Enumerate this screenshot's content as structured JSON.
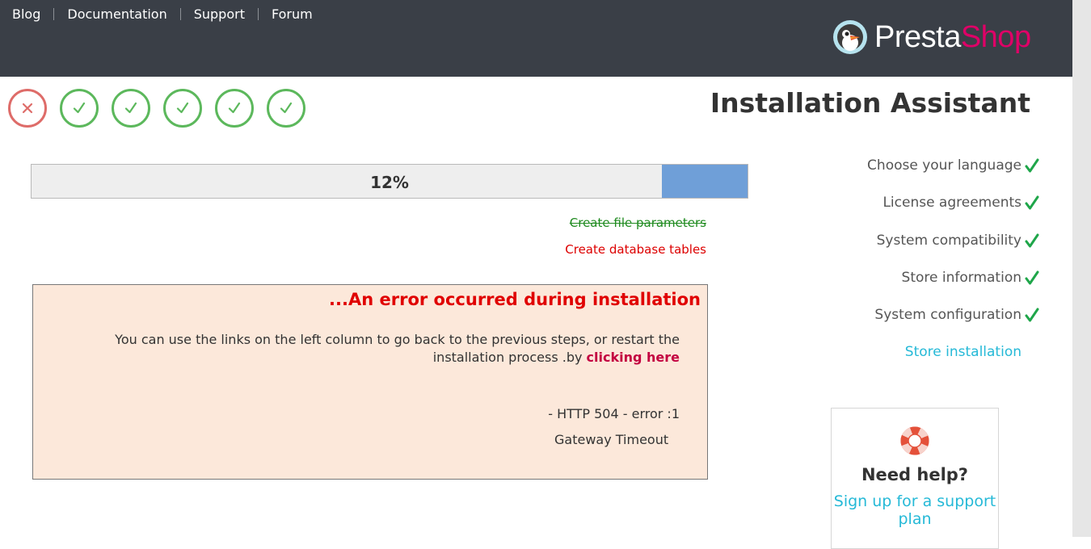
{
  "nav": {
    "items": [
      "Blog",
      "Documentation",
      "Support",
      "Forum"
    ]
  },
  "logo": {
    "part1": "Presta",
    "part2": "Shop"
  },
  "header": {
    "title": "Installation Assistant"
  },
  "step_indicators": {
    "states": [
      "error",
      "done",
      "done",
      "done",
      "done",
      "done"
    ]
  },
  "progress": {
    "percent": 12,
    "label": "12%"
  },
  "tasks": {
    "completed": "Create file parameters",
    "failed": "Create database tables"
  },
  "error": {
    "title": "...An error occurred during installation",
    "message_before": "You can use the links on the left column to go back to the previous steps, or restart the installation process .by ",
    "restart_link": "clicking here",
    "code": "- HTTP 504 - error :1",
    "description": "Gateway Timeout"
  },
  "sidebar": {
    "items": [
      {
        "label": "Choose your language",
        "done": true
      },
      {
        "label": "License agreements",
        "done": true
      },
      {
        "label": "System compatibility",
        "done": true
      },
      {
        "label": "Store information",
        "done": true
      },
      {
        "label": "System configuration",
        "done": true
      },
      {
        "label": "Store installation",
        "done": false
      }
    ]
  },
  "help": {
    "title": "Need help?",
    "link": "Sign up for a support plan",
    "icon": "lifebuoy-icon"
  },
  "colors": {
    "topbar": "#3a3f47",
    "brand_pink": "#df0067",
    "success_green": "#5cb85c",
    "error_red": "#d9534f",
    "accent_cyan": "#25b9d7",
    "progress_fill": "#6f9fd8"
  }
}
